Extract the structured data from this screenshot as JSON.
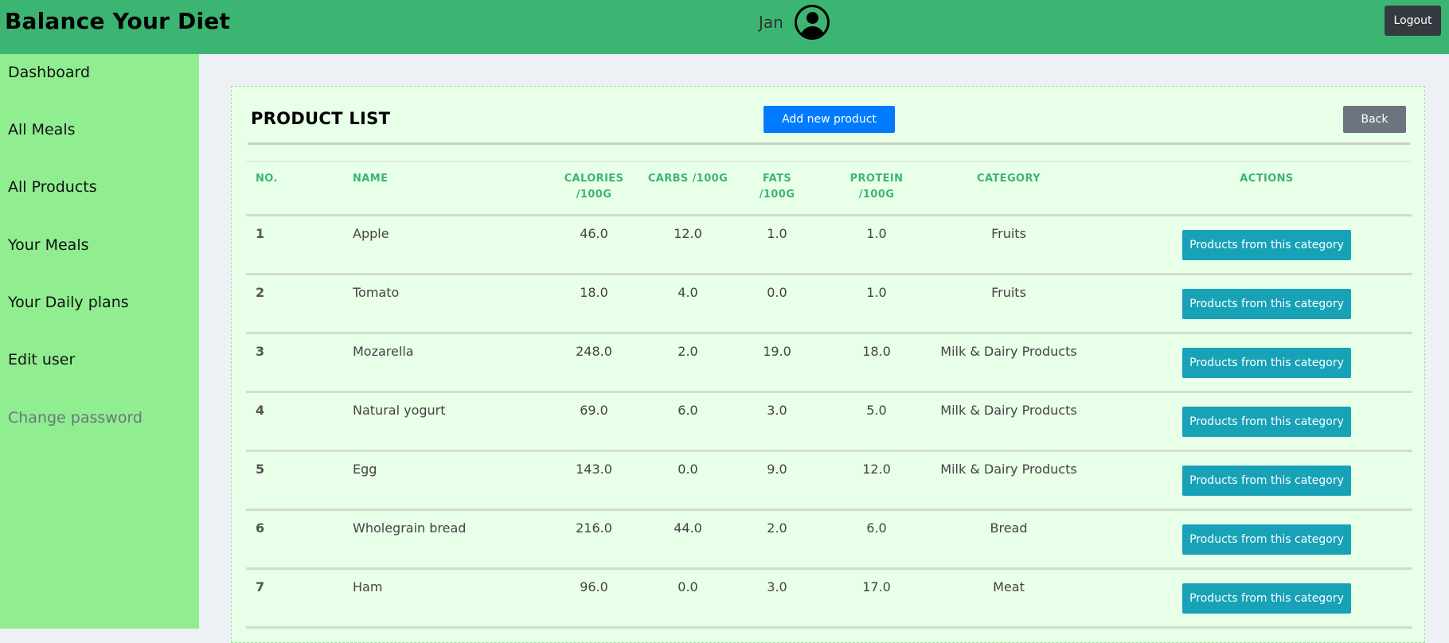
{
  "app": {
    "title": "Balance Your Diet"
  },
  "header": {
    "user_name": "Jan",
    "avatar_icon": "user-circle-icon",
    "logout_label": "Logout"
  },
  "sidebar": {
    "items": [
      {
        "label": "Dashboard"
      },
      {
        "label": "All Meals"
      },
      {
        "label": "All Products"
      },
      {
        "label": "Your Meals"
      },
      {
        "label": "Your Daily plans"
      },
      {
        "label": "Edit user"
      },
      {
        "label": "Change password"
      }
    ]
  },
  "main": {
    "title": "PRODUCT LIST",
    "add_button": "Add new product",
    "back_button": "Back",
    "table": {
      "headers": {
        "no": "No.",
        "name": "Name",
        "calories": "Calories /100g",
        "carbs": "Carbs /100g",
        "fats": "Fats /100g",
        "protein": "Protein /100g",
        "category": "Category",
        "actions": "Actions"
      },
      "rows": [
        {
          "no": "1",
          "name": "Apple",
          "calories": "46.0",
          "carbs": "12.0",
          "fats": "1.0",
          "protein": "1.0",
          "category": "Fruits",
          "action": "Products from this category"
        },
        {
          "no": "2",
          "name": "Tomato",
          "calories": "18.0",
          "carbs": "4.0",
          "fats": "0.0",
          "protein": "1.0",
          "category": "Fruits",
          "action": "Products from this category"
        },
        {
          "no": "3",
          "name": "Mozarella",
          "calories": "248.0",
          "carbs": "2.0",
          "fats": "19.0",
          "protein": "18.0",
          "category": "Milk & Dairy Products",
          "action": "Products from this category"
        },
        {
          "no": "4",
          "name": "Natural yogurt",
          "calories": "69.0",
          "carbs": "6.0",
          "fats": "3.0",
          "protein": "5.0",
          "category": "Milk & Dairy Products",
          "action": "Products from this category"
        },
        {
          "no": "5",
          "name": "Egg",
          "calories": "143.0",
          "carbs": "0.0",
          "fats": "9.0",
          "protein": "12.0",
          "category": "Milk & Dairy Products",
          "action": "Products from this category"
        },
        {
          "no": "6",
          "name": "Wholegrain bread",
          "calories": "216.0",
          "carbs": "44.0",
          "fats": "2.0",
          "protein": "6.0",
          "category": "Bread",
          "action": "Products from this category"
        },
        {
          "no": "7",
          "name": "Ham",
          "calories": "96.0",
          "carbs": "0.0",
          "fats": "3.0",
          "protein": "17.0",
          "category": "Meat",
          "action": "Products from this category"
        }
      ]
    }
  },
  "colors": {
    "header_bg": "#3db572",
    "sidebar_bg": "#90ee90",
    "card_bg": "#e8ffe8",
    "primary": "#007bff",
    "secondary": "#6c757d",
    "info": "#17a2b8",
    "dark": "#343a40"
  }
}
